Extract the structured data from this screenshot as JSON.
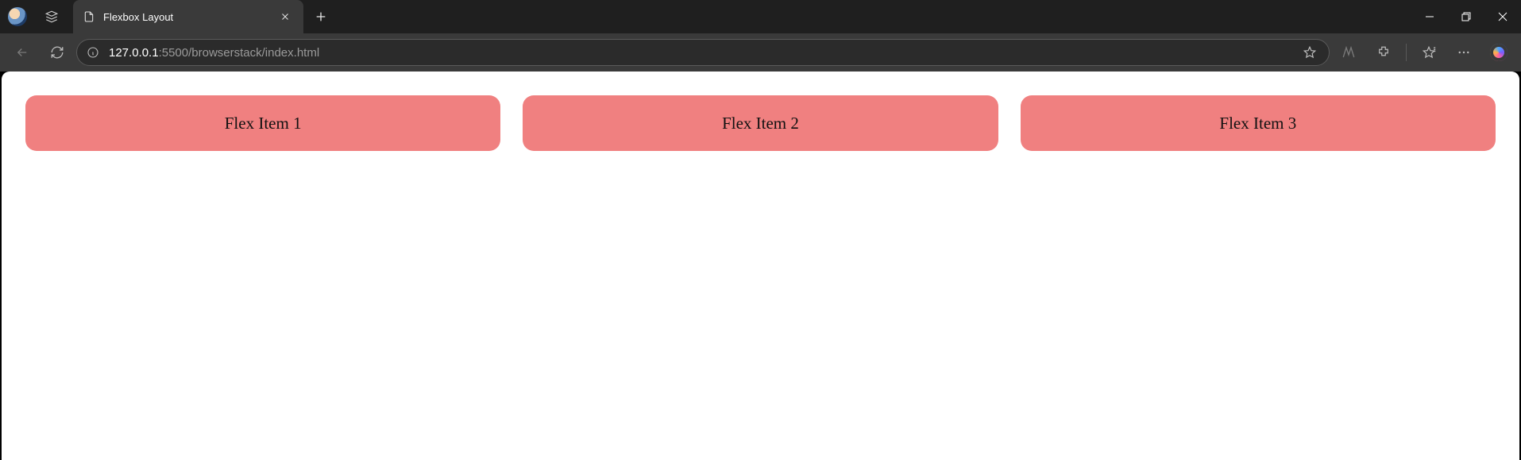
{
  "tab": {
    "title": "Flexbox Layout"
  },
  "url": {
    "host": "127.0.0.1",
    "path": ":5500/browserstack/index.html"
  },
  "page": {
    "items": {
      "0": "Flex Item 1",
      "1": "Flex Item 2",
      "2": "Flex Item 3"
    }
  }
}
